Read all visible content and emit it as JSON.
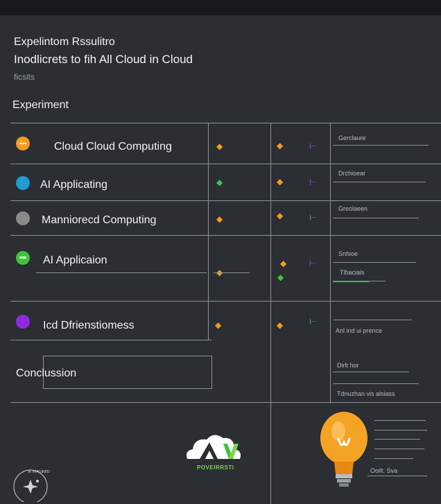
{
  "header": {
    "line1": "Expelintom Rssulitro",
    "line2": "Inodlicrets to fih All Cloud in Cloud",
    "line3": "ficsits"
  },
  "section_label": "Experiment",
  "rows": [
    {
      "label": "Cloud Cloud Computing",
      "color": "#f39c1f",
      "side_label": "Gerclaure"
    },
    {
      "label": "AI Applicating",
      "color": "#1f9bd6",
      "side_label": "Drchioear"
    },
    {
      "label": "Manniorecd Computing",
      "color": "#8a8a8a",
      "side_label": "Greolaeen"
    },
    {
      "label": "AI Applicaion",
      "color": "#3fc43a",
      "side_label": "Snfsoe",
      "side_label_2": "Tlbacials"
    },
    {
      "label": "Icd Dfrienstiomess",
      "color": "#8e2be2",
      "side_label": "Anl ind ui prence"
    }
  ],
  "conclusion": "Conclussion",
  "conclusion_side": [
    "Dirlt hor",
    "Tdnuzhan vis alsiass"
  ],
  "logo_text": "POVEIRRSTI",
  "bulb_label": "Ooilt. Sva",
  "badge_text": "AI IMAGINED",
  "colors": {
    "background": "#2b2e33",
    "orange": "#f39c1f",
    "green": "#3fc43a",
    "purple": "#8e2be2"
  }
}
